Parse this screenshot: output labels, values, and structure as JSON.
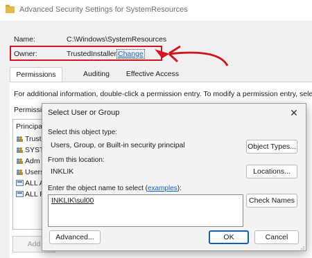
{
  "window": {
    "title": "Advanced Security Settings for SystemResources",
    "name_label": "Name:",
    "name_value": "C:\\Windows\\SystemResources",
    "owner_label": "Owner:",
    "owner_value": "TrustedInstaller",
    "change_link": "Change",
    "tabs": [
      "Permissions",
      "Auditing",
      "Effective Access"
    ],
    "info_text": "For additional information, double-click a permission entry. To modify a permission entry, select the",
    "permissions_label_partial": "Permissio",
    "principals_header_partial": "Principa",
    "principals": [
      "Trust",
      "SYST",
      "Adm",
      "Users",
      "ALL A",
      "ALL R"
    ],
    "add_button_partial": "Add"
  },
  "dialog": {
    "title": "Select User or Group",
    "object_type_label": "Select this object type:",
    "object_type_value": "Users, Group, or Built-in security principal",
    "object_types_button": "Object Types...",
    "location_label": "From this location:",
    "location_value": "INKLIK",
    "locations_button": "Locations...",
    "enter_label_prefix": "Enter the object name to select (",
    "examples_link": "examples",
    "enter_label_suffix": "):",
    "object_name_value": "INKLIK\\sul00",
    "check_names_button": "Check Names",
    "advanced_button": "Advanced...",
    "ok_button": "OK",
    "cancel_button": "Cancel"
  },
  "colors": {
    "annotation_red": "#d4141c",
    "link_blue": "#1565c0",
    "primary_button_border": "#0a62c9"
  }
}
